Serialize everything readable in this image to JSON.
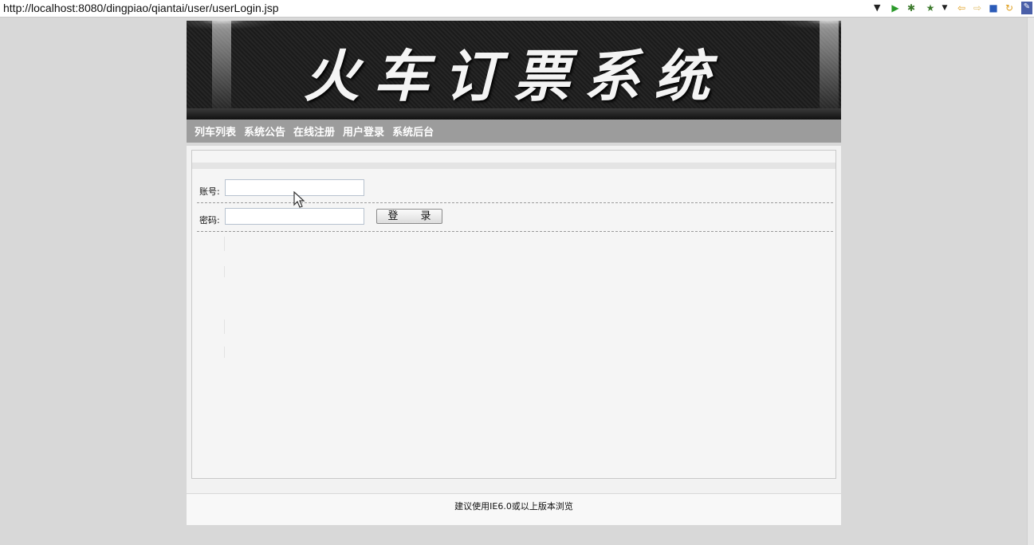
{
  "browser": {
    "url": "http://localhost:8080/dingpiao/qiantai/user/userLogin.jsp",
    "toolbar_icons": [
      "dropdown-icon",
      "run-icon",
      "debug-icon",
      "bookmark-icon",
      "dropdown-icon",
      "back-icon",
      "forward-icon",
      "stop-icon",
      "refresh-icon",
      "app-icon"
    ]
  },
  "header": {
    "title": "火车订票系统"
  },
  "nav": {
    "items": [
      {
        "label": "列车列表"
      },
      {
        "label": "系统公告"
      },
      {
        "label": "在线注册"
      },
      {
        "label": "用户登录"
      },
      {
        "label": "系统后台"
      }
    ]
  },
  "login": {
    "account_label": "账号:",
    "account_value": "",
    "password_label": "密码:",
    "password_value": "",
    "submit_label": "登 录"
  },
  "footer": {
    "text": "建议使用IE6.0或以上版本浏览"
  }
}
